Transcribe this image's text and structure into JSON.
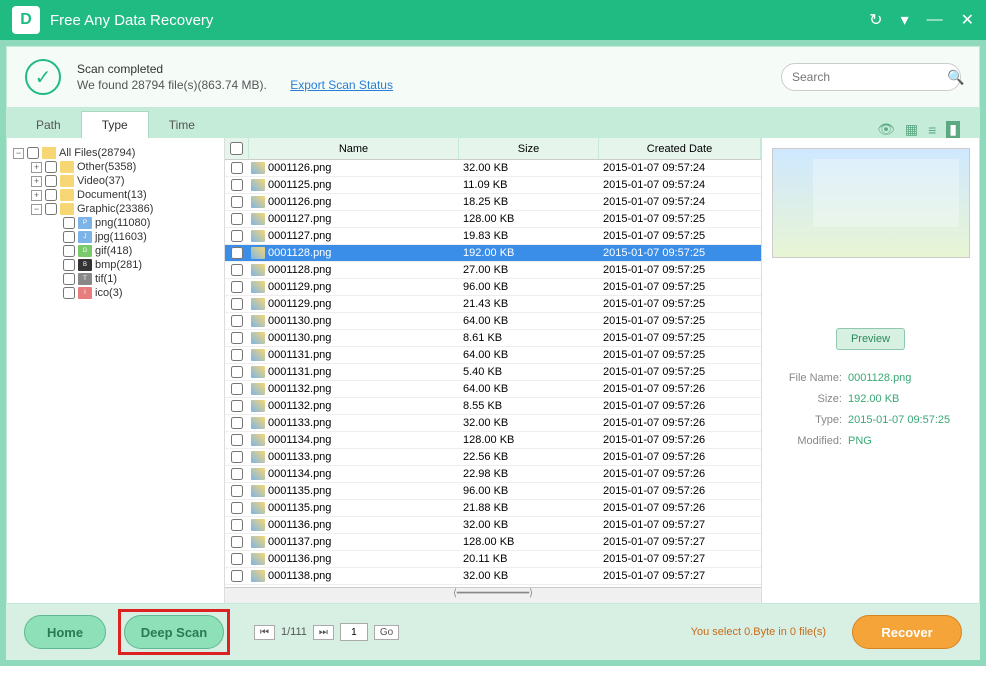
{
  "app": {
    "title": "Free Any Data Recovery"
  },
  "status": {
    "line1": "Scan completed",
    "line2": "We found 28794 file(s)(863.74 MB).",
    "export": "Export Scan Status"
  },
  "search": {
    "placeholder": "Search"
  },
  "tabs": {
    "path": "Path",
    "type": "Type",
    "time": "Time"
  },
  "tree": {
    "root": "All Files(28794)",
    "other": "Other(5358)",
    "video": "Video(37)",
    "document": "Document(13)",
    "graphic": "Graphic(23386)",
    "png": "png(11080)",
    "jpg": "jpg(11603)",
    "gif": "gif(418)",
    "bmp": "bmp(281)",
    "tif": "tif(1)",
    "ico": "ico(3)"
  },
  "columns": {
    "name": "Name",
    "size": "Size",
    "date": "Created Date"
  },
  "files": [
    {
      "name": "0001126.png",
      "size": "32.00 KB",
      "date": "2015-01-07 09:57:24"
    },
    {
      "name": "0001125.png",
      "size": "11.09 KB",
      "date": "2015-01-07 09:57:24"
    },
    {
      "name": "0001126.png",
      "size": "18.25 KB",
      "date": "2015-01-07 09:57:24"
    },
    {
      "name": "0001127.png",
      "size": "128.00 KB",
      "date": "2015-01-07 09:57:25"
    },
    {
      "name": "0001127.png",
      "size": "19.83 KB",
      "date": "2015-01-07 09:57:25"
    },
    {
      "name": "0001128.png",
      "size": "192.00 KB",
      "date": "2015-01-07 09:57:25",
      "selected": true
    },
    {
      "name": "0001128.png",
      "size": "27.00 KB",
      "date": "2015-01-07 09:57:25"
    },
    {
      "name": "0001129.png",
      "size": "96.00 KB",
      "date": "2015-01-07 09:57:25"
    },
    {
      "name": "0001129.png",
      "size": "21.43 KB",
      "date": "2015-01-07 09:57:25"
    },
    {
      "name": "0001130.png",
      "size": "64.00 KB",
      "date": "2015-01-07 09:57:25"
    },
    {
      "name": "0001130.png",
      "size": "8.61 KB",
      "date": "2015-01-07 09:57:25"
    },
    {
      "name": "0001131.png",
      "size": "64.00 KB",
      "date": "2015-01-07 09:57:25"
    },
    {
      "name": "0001131.png",
      "size": "5.40 KB",
      "date": "2015-01-07 09:57:25"
    },
    {
      "name": "0001132.png",
      "size": "64.00 KB",
      "date": "2015-01-07 09:57:26"
    },
    {
      "name": "0001132.png",
      "size": "8.55 KB",
      "date": "2015-01-07 09:57:26"
    },
    {
      "name": "0001133.png",
      "size": "32.00 KB",
      "date": "2015-01-07 09:57:26"
    },
    {
      "name": "0001134.png",
      "size": "128.00 KB",
      "date": "2015-01-07 09:57:26"
    },
    {
      "name": "0001133.png",
      "size": "22.56 KB",
      "date": "2015-01-07 09:57:26"
    },
    {
      "name": "0001134.png",
      "size": "22.98 KB",
      "date": "2015-01-07 09:57:26"
    },
    {
      "name": "0001135.png",
      "size": "96.00 KB",
      "date": "2015-01-07 09:57:26"
    },
    {
      "name": "0001135.png",
      "size": "21.88 KB",
      "date": "2015-01-07 09:57:26"
    },
    {
      "name": "0001136.png",
      "size": "32.00 KB",
      "date": "2015-01-07 09:57:27"
    },
    {
      "name": "0001137.png",
      "size": "128.00 KB",
      "date": "2015-01-07 09:57:27"
    },
    {
      "name": "0001136.png",
      "size": "20.11 KB",
      "date": "2015-01-07 09:57:27"
    },
    {
      "name": "0001138.png",
      "size": "32.00 KB",
      "date": "2015-01-07 09:57:27"
    }
  ],
  "preview": {
    "button": "Preview",
    "filename_label": "File Name:",
    "filename": "0001128.png",
    "size_label": "Size:",
    "size": "192.00 KB",
    "type_label": "Type:",
    "type": "2015-01-07 09:57:25",
    "modified_label": "Modified:",
    "modified": "PNG"
  },
  "footer": {
    "home": "Home",
    "deep": "Deep Scan",
    "pager": "1/111",
    "pagenum": "1",
    "go": "Go",
    "selection": "You select 0.Byte in 0 file(s)",
    "recover": "Recover"
  }
}
